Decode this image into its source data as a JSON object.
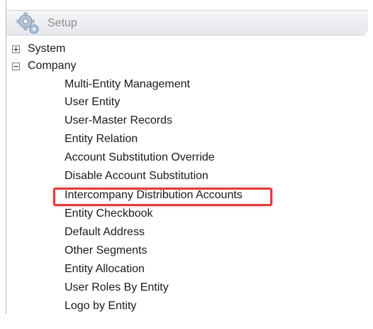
{
  "header": {
    "title": "Setup",
    "icon": "gear-icon"
  },
  "tree": {
    "categories": [
      {
        "label": "System",
        "expanded": false
      },
      {
        "label": "Company",
        "expanded": true
      }
    ],
    "company_items": [
      "Multi-Entity Management",
      "User Entity",
      "User-Master Records",
      "Entity Relation",
      "Account Substitution Override",
      "Disable Account Substitution",
      "Intercompany Distribution Accounts",
      "Entity Checkbook",
      "Default Address",
      "Other Segments",
      "Entity Allocation",
      "User Roles By Entity",
      "Logo by Entity"
    ],
    "highlighted_item": "Intercompany Distribution Accounts"
  },
  "colors": {
    "highlight": "#e33b3b",
    "header_text": "#8c8c8c"
  }
}
